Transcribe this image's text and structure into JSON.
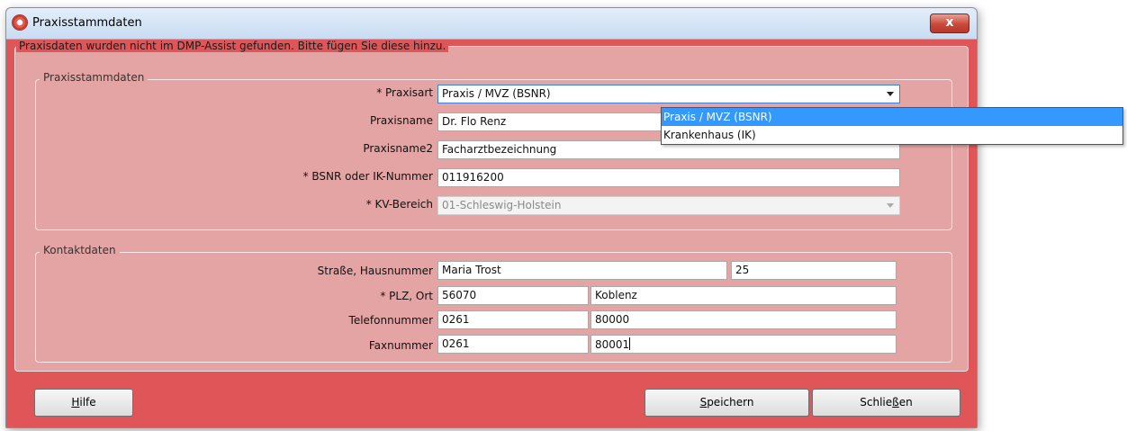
{
  "window": {
    "title": "Praxisstammdaten",
    "close_symbol": "x"
  },
  "notice": "Praxisdaten wurden nicht im DMP-Assist gefunden. Bitte fügen Sie diese hinzu.",
  "praxis_group": {
    "legend": "Praxisstammdaten",
    "praxisart_label": "* Praxisart",
    "praxisart_value": "Praxis / MVZ (BSNR)",
    "praxisname_label": "Praxisname",
    "praxisname_value": "Dr. Flo Renz",
    "praxisname2_label": "Praxisname2",
    "praxisname2_value": "Facharztbezeichnung",
    "bsnr_label": "* BSNR oder IK-Nummer",
    "bsnr_value": "011916200",
    "kv_label": "* KV-Bereich",
    "kv_value": "01-Schleswig-Holstein"
  },
  "dropdown": {
    "options": [
      "Praxis / MVZ (BSNR)",
      "Krankenhaus (IK)"
    ],
    "selected_index": 0
  },
  "kontakt_group": {
    "legend": "Kontaktdaten",
    "strasse_label": "Straße, Hausnummer",
    "strasse_value": "Maria Trost",
    "hausnummer_value": "25",
    "plz_label": "* PLZ, Ort",
    "plz_value": "56070",
    "ort_value": "Koblenz",
    "telefon_label": "Telefonnummer",
    "telefon_vorwahl": "0261",
    "telefon_nummer": "80000",
    "fax_label": "Faxnummer",
    "fax_vorwahl": "0261",
    "fax_nummer": "80001"
  },
  "buttons": {
    "hilfe_mnemonic": "H",
    "hilfe_rest": "ilfe",
    "speichern_mnemonic": "S",
    "speichern_rest": "peichern",
    "schliessen_pre": "Schlie",
    "schliessen_mnemonic": "ß",
    "schliessen_post": "en"
  }
}
